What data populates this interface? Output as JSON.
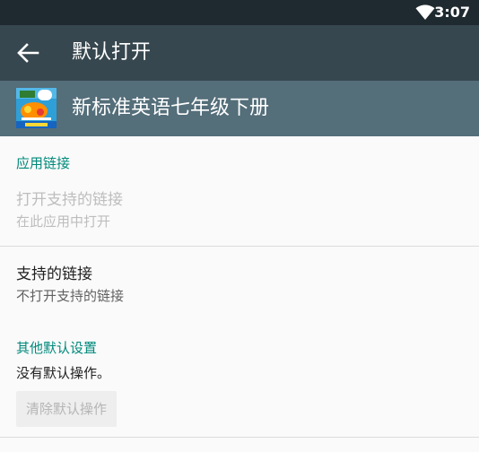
{
  "status_bar": {
    "time": "3:07",
    "icons": [
      "wifi-icon"
    ]
  },
  "toolbar": {
    "title": "默认打开",
    "back_icon": "arrow-left-icon"
  },
  "app": {
    "name": "新标准英语七年级下册",
    "icon": "app-book-icon"
  },
  "app_links": {
    "section_title": "应用链接",
    "open_supported_links": {
      "title": "打开支持的链接",
      "summary": "在此应用中打开"
    },
    "supported_links": {
      "title": "支持的链接",
      "summary": "不打开支持的链接"
    }
  },
  "other_defaults": {
    "section_title": "其他默认设置",
    "summary": "没有默认操作。",
    "clear_button_label": "清除默认操作"
  },
  "colors": {
    "status_bar": "#1f2a30",
    "app_bar": "#37474f",
    "app_header": "#546e7a",
    "accent": "#00897b",
    "background": "#fafafa"
  }
}
